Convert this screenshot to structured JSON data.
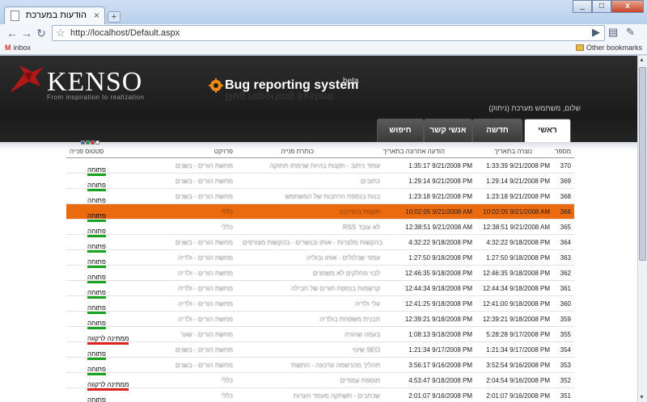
{
  "browser": {
    "tab_title": "הודעות במערכת",
    "tab_close": "×",
    "new_tab": "+",
    "url": "http://localhost/Default.aspx",
    "bookmarks": {
      "inbox": "inbox",
      "other": "Other bookmarks"
    },
    "window_buttons": {
      "minimize": "_",
      "maximize": "□",
      "close": "x"
    }
  },
  "header": {
    "logo": "KENSO",
    "tagline": "From inspiration to realization",
    "brand_title": "Bug reporting system",
    "brand_beta": "beta",
    "brand_reflection": "Bug reporting system",
    "greeting": "שלום, משתמש מערכת (ניתוק)"
  },
  "nav": {
    "tabs": [
      {
        "label": "ראשי",
        "active": true
      },
      {
        "label": "חדשה",
        "active": false
      },
      {
        "label": "אנשי קשר",
        "active": false
      },
      {
        "label": "חיפוש",
        "active": false
      }
    ]
  },
  "table": {
    "headers": {
      "number": "מספר",
      "created": "נוצרה בתאריך",
      "updated": "הודעה אחרונה בתאריך",
      "title": "כותרת פנייה",
      "project": "פרויקט",
      "status": "סטטוס פנייה"
    },
    "status_legend_colors": [
      "#2a6ad0",
      "#1aa322",
      "#dd2222",
      "#ffffff"
    ],
    "rows": [
      {
        "num": "370",
        "created": "1:33:39 9/21/2008 PM",
        "updated": "1:35:17 9/21/2008 PM",
        "title": "עמוד ניתוב - תקנות בהיות שרמתו תחזקה",
        "project": "מחשת הורים - בשנים",
        "status": "פתוחה",
        "status_type": "open",
        "highlight": false
      },
      {
        "num": "369",
        "created": "1:29:14 9/21/2008 PM",
        "updated": "1:29:14 9/21/2008 PM",
        "title": "כתובים",
        "project": "מחשת הורים - בשנים",
        "status": "פתוחה",
        "status_type": "open",
        "highlight": false
      },
      {
        "num": "368",
        "created": "1:23:18 9/21/2008 PM",
        "updated": "1:23:18 9/21/2008 PM",
        "title": "בנות בנספח הרחבות של המשתמש",
        "project": "מחשת הורים - בשנים",
        "status": "פתוחה",
        "status_type": "open",
        "highlight": false
      },
      {
        "num": "366",
        "created": "10:02:05 9/21/2008 AM",
        "updated": "10:02:05 9/21/2008 AM",
        "title": "תקנות בהדרכה",
        "project": "כללי",
        "status": "פתוחה",
        "status_type": "open",
        "highlight": true
      },
      {
        "num": "365",
        "created": "12:38:51 9/21/2008 AM",
        "updated": "12:38:51 9/21/2008 AM",
        "title": "RSS לא עובד",
        "project": "כללי",
        "status": "פתוחה",
        "status_type": "open",
        "highlight": false
      },
      {
        "num": "364",
        "created": "4:32:22 9/18/2008 PM",
        "updated": "4:32:22 9/18/2008 PM",
        "title": "בהקשות מלצרות - אותו ובנשרים - בהקשות מצורפים",
        "project": "מחשת הורים - בשנים",
        "status": "פתוחה",
        "status_type": "open",
        "highlight": false
      },
      {
        "num": "363",
        "created": "1:27:50 9/18/2008 PM",
        "updated": "1:27:50 9/18/2008 PM",
        "title": "עמוד שכלולים - אותו ובוליה",
        "project": "מחשת הורים - ולדיה",
        "status": "פתוחה",
        "status_type": "open",
        "highlight": false
      },
      {
        "num": "362",
        "created": "12:46:35 9/18/2008 PM",
        "updated": "12:46:35 9/18/2008 PM",
        "title": "לבוי מחלקים לא משמנים",
        "project": "מחשת הורים - ולדיה",
        "status": "פתוחה",
        "status_type": "open",
        "highlight": false
      },
      {
        "num": "361",
        "created": "12:44:34 9/18/2008 PM",
        "updated": "12:44:34 9/18/2008 PM",
        "title": "קרשמות בנספח חורים של חבילה",
        "project": "מחשת הורים - ולדיה",
        "status": "פתוחה",
        "status_type": "open",
        "highlight": false
      },
      {
        "num": "360",
        "created": "12:41:00 9/18/2008 PM",
        "updated": "12:41:25 9/18/2008 PM",
        "title": "עלי ולדיה",
        "project": "מחשת הורים - ולדיה",
        "status": "פתוחה",
        "status_type": "open",
        "highlight": false
      },
      {
        "num": "359",
        "created": "12:39:21 9/18/2008 PM",
        "updated": "12:39:21 9/18/2008 PM",
        "title": "תבנית משפחת בולדיה",
        "project": "מחשת הורים - ולדיה",
        "status": "פתוחה",
        "status_type": "open",
        "highlight": false
      },
      {
        "num": "355",
        "created": "5:28:28 9/17/2008 PM",
        "updated": "1:08:13 9/18/2008 PM",
        "title": "בעמה שהורה",
        "project": "מחשת הורים - שער",
        "status": "ממתינה לרקווה",
        "status_type": "wait",
        "highlight": false
      },
      {
        "num": "354",
        "created": "1:21:34 9/17/2008 PM",
        "updated": "1:21:34 9/17/2008 PM",
        "title": "שינוי SEO",
        "project": "מחשת הורים - בשנים",
        "status": "פתוחה",
        "status_type": "open",
        "highlight": false
      },
      {
        "num": "353",
        "created": "3:52:54 9/16/2008 PM",
        "updated": "3:56:17 9/16/2008 PM",
        "title": "תהליך מהרשמה עדכונה - התשתי",
        "project": "מחשת הורים - בשנים",
        "status": "פתוחה",
        "status_type": "open",
        "highlight": false
      },
      {
        "num": "352",
        "created": "2:04:54 9/16/2008 PM",
        "updated": "4:53:47 9/18/2008 PM",
        "title": "תוספת עמודים",
        "project": "כללי",
        "status": "ממתינה לרקווה",
        "status_type": "wait",
        "highlight": false
      },
      {
        "num": "351",
        "created": "2:01:07 9/16/2008 PM",
        "updated": "2:01:07 9/16/2008 PM",
        "title": "שכתבים - תשתקה מעמד הערות",
        "project": "כללי",
        "status": "פתוחה",
        "status_type": "open",
        "highlight": false
      }
    ]
  }
}
